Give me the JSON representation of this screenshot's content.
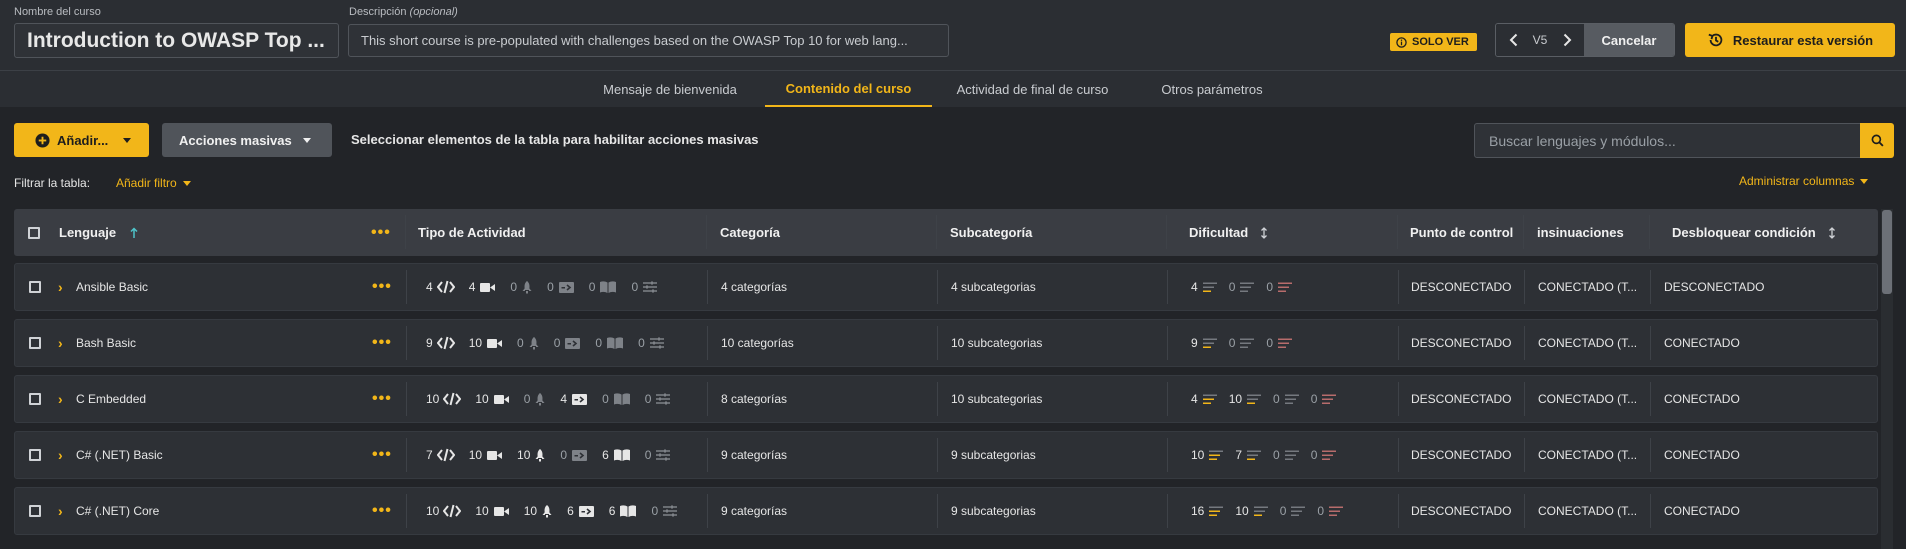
{
  "header": {
    "course_name_label": "Nombre del curso",
    "course_name": "Introduction to OWASP Top ...",
    "description_label": "Descripción",
    "description_label_optional": "(opcional)",
    "description": "This short course is pre-populated with challenges based on the OWASP Top 10 for web lang...",
    "view_only_badge": "SOLO VER",
    "version": "V5",
    "cancel_label": "Cancelar",
    "restore_label": "Restaurar esta versión"
  },
  "tabs": [
    {
      "label": "Mensaje de bienvenida",
      "active": false
    },
    {
      "label": "Contenido del curso",
      "active": true
    },
    {
      "label": "Actividad de final de curso",
      "active": false
    },
    {
      "label": "Otros parámetros",
      "active": false
    }
  ],
  "toolbar": {
    "add_label": "Añadir...",
    "bulk_label": "Acciones masivas",
    "bulk_hint": "Seleccionar elementos de la tabla para habilitar acciones masivas",
    "search_placeholder": "Buscar lenguajes y módulos...",
    "filter_label": "Filtrar la tabla:",
    "add_filter_label": "Añadir filtro",
    "manage_columns_label": "Administrar columnas"
  },
  "table": {
    "columns": {
      "language": "Lenguaje",
      "activity_type": "Tipo de Actividad",
      "category": "Categoría",
      "subcategory": "Subcategoría",
      "difficulty": "Dificultad",
      "checkpoint": "Punto de control",
      "hints": "insinuaciones",
      "unlock": "Desbloquear condición"
    },
    "rows": [
      {
        "language": "Ansible Basic",
        "activities": [
          4,
          4,
          0,
          0,
          0,
          0
        ],
        "difficulty": [
          4,
          0,
          0
        ],
        "category": "4 categorías",
        "subcategory": "4 subcategorias",
        "checkpoint": "DESCONECTADO",
        "hints": "CONECTADO (T...",
        "unlock": "DESCONECTADO"
      },
      {
        "language": "Bash Basic",
        "activities": [
          9,
          10,
          0,
          0,
          0,
          0
        ],
        "difficulty": [
          9,
          0,
          0
        ],
        "category": "10 categorías",
        "subcategory": "10 subcategorias",
        "checkpoint": "DESCONECTADO",
        "hints": "CONECTADO (T...",
        "unlock": "CONECTADO"
      },
      {
        "language": "C Embedded",
        "activities": [
          10,
          10,
          0,
          4,
          0,
          0
        ],
        "difficulty": [
          4,
          10,
          0,
          0
        ],
        "category": "8 categorías",
        "subcategory": "10 subcategorias",
        "checkpoint": "DESCONECTADO",
        "hints": "CONECTADO (T...",
        "unlock": "CONECTADO"
      },
      {
        "language": "C# (.NET) Basic",
        "activities": [
          7,
          10,
          10,
          0,
          6,
          0
        ],
        "difficulty": [
          10,
          7,
          0,
          0
        ],
        "category": "9 categorías",
        "subcategory": "9 subcategorias",
        "checkpoint": "DESCONECTADO",
        "hints": "CONECTADO (T...",
        "unlock": "CONECTADO"
      },
      {
        "language": "C# (.NET) Core",
        "activities": [
          10,
          10,
          10,
          6,
          6,
          0
        ],
        "difficulty": [
          16,
          10,
          0,
          0
        ],
        "category": "9 categorías",
        "subcategory": "9 subcategorias",
        "checkpoint": "DESCONECTADO",
        "hints": "CONECTADO (T...",
        "unlock": "CONECTADO"
      }
    ]
  },
  "colors": {
    "accent": "#f2b619",
    "background": "#2b2e33",
    "table_bg": "#222428",
    "row_bg": "#2d3035",
    "easy": "#f2b619",
    "hard": "#d98080"
  }
}
